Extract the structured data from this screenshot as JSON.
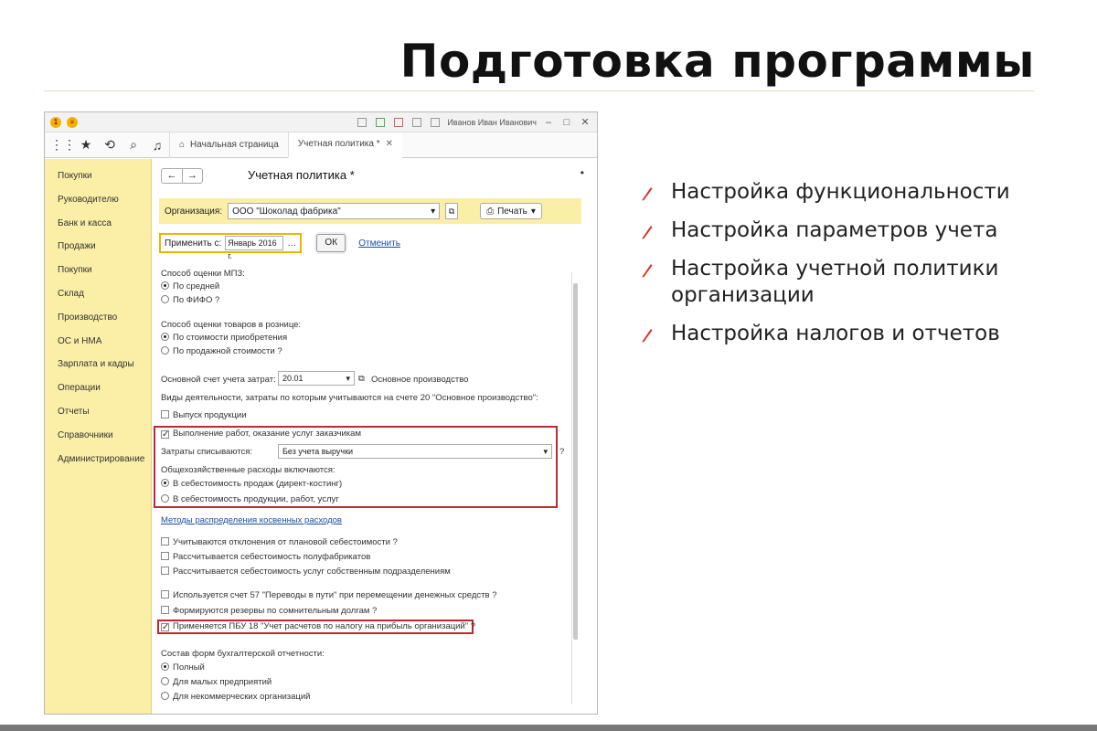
{
  "slide": {
    "title": "Подготовка программы",
    "bullets": [
      "Настройка функциональности",
      "Настройка параметров учета",
      "Настройка учетной политики организации",
      "Настройка налогов и отчетов"
    ],
    "colors": {
      "accent": "#d93025",
      "sidebar": "#fbeea6",
      "highlight": "#c0282d"
    }
  },
  "app": {
    "titlebar": {
      "user": "Иванов Иван Иванович"
    },
    "toolbar_icons": [
      "apps-grid-icon",
      "star-icon",
      "history-icon",
      "search-icon",
      "bell-icon"
    ],
    "tabs": [
      {
        "label": "Начальная страница",
        "icon": "home-icon"
      },
      {
        "label": "Учетная политика *",
        "closable": true
      }
    ],
    "sidebar": [
      "Покупки",
      "Руководителю",
      "Банк и касса",
      "Продажи",
      "Покупки",
      "Склад",
      "Производство",
      "ОС и НМА",
      "Зарплата и кадры",
      "Операции",
      "Отчеты",
      "Справочники",
      "Администрирование"
    ],
    "form": {
      "title": "Учетная политика *",
      "nav_back": "←",
      "nav_forward": "→",
      "org_label": "Организация:",
      "org_value": "ООО \"Шоколад фабрика\"",
      "print_label": "Печать",
      "apply_label": "Применить с:",
      "apply_date": "Январь 2016 г.",
      "ok_label": "ОК",
      "cancel_label": "Отменить",
      "mpz_label": "Способ оценки МПЗ:",
      "mpz_options": [
        "По средней",
        "По ФИФО ?"
      ],
      "retail_label": "Способ оценки товаров в рознице:",
      "retail_options": [
        "По стоимости приобретения",
        "По продажной стоимости ?"
      ],
      "main_account_label": "Основной счет учета затрат:",
      "main_account_value": "20.01",
      "main_account_desc": "Основное производство",
      "activities_label": "Виды деятельности, затраты по которым учитываются на счете 20 \"Основное производство\":",
      "activity_release": "Выпуск продукции",
      "activity_services": "Выполнение работ, оказание услуг заказчикам",
      "cost_label": "Затраты списываются:",
      "cost_value": "Без учета выручки",
      "general_label": "Общехозяйственные расходы включаются:",
      "general_options": [
        "В себестоимость продаж (директ-костинг)",
        "В себестоимость продукции, работ, услуг"
      ],
      "methods_link": "Методы распределения косвенных расходов",
      "checks_a": [
        "Учитываются отклонения от плановой себестоимости ?",
        "Рассчитывается себестоимость полуфабрикатов",
        "Рассчитывается себестоимость услуг собственным подразделениям"
      ],
      "checks_b": [
        "Используется счет 57 \"Переводы в пути\" при перемещении денежных средств ?",
        "Формируются резервы по сомнительным долгам ?"
      ],
      "pbu18": "Применяется ПБУ 18 \"Учет расчетов по налогу на прибыль организаций\" ?",
      "reporting_label": "Состав форм бухгалтерской отчетности:",
      "reporting_options": [
        "Полный",
        "Для малых предприятий",
        "Для некоммерческих организаций"
      ]
    }
  }
}
